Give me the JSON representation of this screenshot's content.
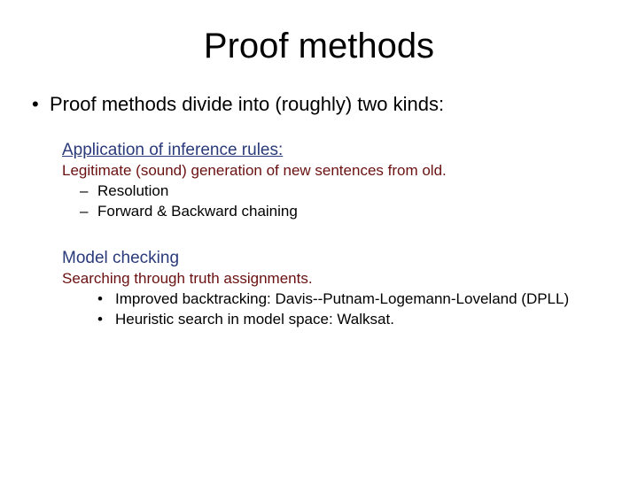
{
  "title": "Proof methods",
  "top_bullet": "Proof methods divide into (roughly) two kinds:",
  "sections": [
    {
      "heading": "Application of inference rules:",
      "underline": true,
      "sub": "Legitimate (sound) generation of new sentences from old.",
      "marker": "–",
      "items": [
        "Resolution",
        "Forward & Backward chaining"
      ]
    },
    {
      "heading": "Model checking",
      "underline": false,
      "sub": "Searching through truth assignments.",
      "marker": "•",
      "items": [
        "Improved backtracking: Davis--Putnam-Logemann-Loveland (DPLL)",
        "Heuristic search in model space: Walksat."
      ]
    }
  ]
}
